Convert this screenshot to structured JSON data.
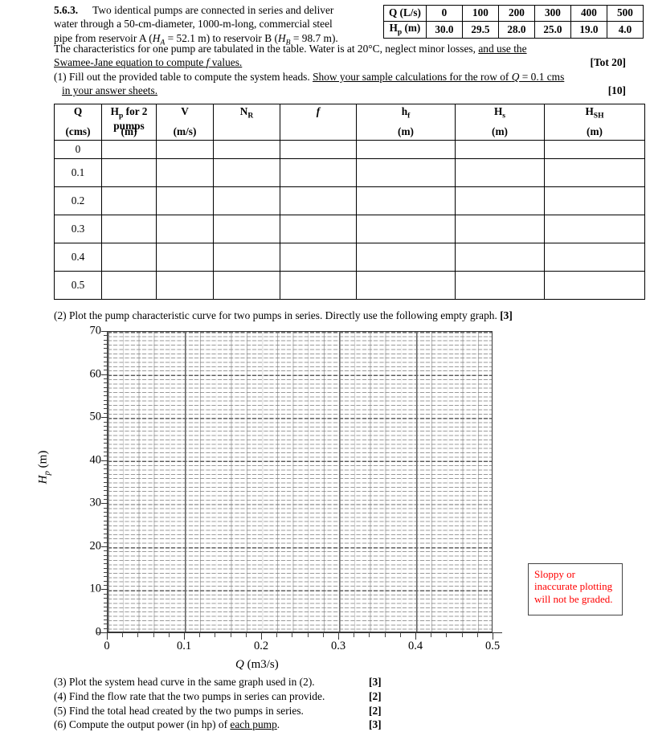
{
  "problem": {
    "number": "5.6.3.",
    "paragraph_1": "Two identical pumps are connected in series and deliver water through a 50-cm-diameter, 1000-m-long, commercial steel pipe from reservoir A (H_A = 52.1 m) to reservoir B (H_B = 98.7 m).",
    "line1": "Two identical pumps are connected in series and deliver",
    "line2a": "water through a 50-cm-diameter, 1000-m-long, commercial steel",
    "line3a": "pipe from reservoir A (",
    "line3b": " = 52.1 m) to reservoir B (",
    "line3c": " = 98.7 m).",
    "ha_sym": "H",
    "ha_sub": "A",
    "hb_sym": "H",
    "hb_sub": "B",
    "line4a": "The characteristics for one pump are tabulated in the table. Water is at 20°C, neglect minor losses, ",
    "line4b": "and use the ",
    "line5a": "Swamee-Jane equation to compute ",
    "line5_f": "f",
    "line5b": " values.",
    "tot_mark": "[Tot 20]",
    "item1_a": "(1) Fill out the provided table to compute the system heads. ",
    "item1_b": "Show your sample calculations for the row of ",
    "item1_q": "Q",
    "item1_c": " = 0.1 cms",
    "item1_d": "in your answer sheets.",
    "item1_mark": "[10]"
  },
  "pump_table": {
    "row_q_label": "Q (L/s)",
    "row_hp_label_main": "H",
    "row_hp_label_sub": "p",
    "row_hp_label_rest": " (m)",
    "q_values": [
      "0",
      "100",
      "200",
      "300",
      "400",
      "500"
    ],
    "hp_values": [
      "30.0",
      "29.5",
      "28.0",
      "25.0",
      "19.0",
      "4.0"
    ]
  },
  "main_table": {
    "headers": [
      {
        "main": "Q",
        "sub": "",
        "second": "",
        "unit": "(cms)"
      },
      {
        "main": "H",
        "sub": "p",
        "second": " for 2",
        "second_line": "pumps",
        "unit": "(m)"
      },
      {
        "main": "V",
        "sub": "",
        "second": "",
        "unit": "(m/s)"
      },
      {
        "main": "N",
        "sub": "R",
        "second": "",
        "unit": ""
      },
      {
        "main": "f",
        "sub": "",
        "second": "",
        "unit": ""
      },
      {
        "main": "h",
        "sub": "f",
        "second": "",
        "unit": "(m)"
      },
      {
        "main": "H",
        "sub": "s",
        "second": "",
        "unit": "(m)"
      },
      {
        "main": "H",
        "sub": "SH",
        "second": "",
        "unit": "(m)"
      }
    ],
    "header_hp_text": "H",
    "header_hp_sub": "p",
    "header_hp_rest": " for 2",
    "header_hp_line2": "pumps",
    "rows": [
      {
        "q": "0",
        "hp": "",
        "v": "",
        "nr": "",
        "f": "",
        "hf": "",
        "hs": "",
        "hsh": ""
      },
      {
        "q": "0.1",
        "hp": "",
        "v": "",
        "nr": "",
        "f": "",
        "hf": "",
        "hs": "",
        "hsh": ""
      },
      {
        "q": "0.2",
        "hp": "",
        "v": "",
        "nr": "",
        "f": "",
        "hf": "",
        "hs": "",
        "hsh": ""
      },
      {
        "q": "0.3",
        "hp": "",
        "v": "",
        "nr": "",
        "f": "",
        "hf": "",
        "hs": "",
        "hsh": ""
      },
      {
        "q": "0.4",
        "hp": "",
        "v": "",
        "nr": "",
        "f": "",
        "hf": "",
        "hs": "",
        "hsh": ""
      },
      {
        "q": "0.5",
        "hp": "",
        "v": "",
        "nr": "",
        "f": "",
        "hf": "",
        "hs": "",
        "hsh": ""
      }
    ]
  },
  "item2": {
    "text": "(2) Plot the pump characteristic curve for two pumps in series. Directly use the following empty graph. ",
    "mark": "[3]"
  },
  "chart_data": {
    "type": "line",
    "title": "",
    "xlabel_main": "Q",
    "xlabel_unit": " (m3/s)",
    "ylabel_main": "H",
    "ylabel_sub": "p",
    "ylabel_unit": " (m)",
    "x_ticks": [
      "0",
      "0.1",
      "0.2",
      "0.3",
      "0.4",
      "0.5"
    ],
    "x_tick_values": [
      0,
      0.1,
      0.2,
      0.3,
      0.4,
      0.5
    ],
    "y_ticks": [
      "0",
      "10",
      "20",
      "30",
      "40",
      "50",
      "60",
      "70"
    ],
    "y_tick_values": [
      0,
      10,
      20,
      30,
      40,
      50,
      60,
      70
    ],
    "xlim": [
      0,
      0.5
    ],
    "ylim": [
      0,
      70
    ],
    "x_minor_per_major": 5,
    "y_minor_per_major": 10,
    "grid": true,
    "grid_style": "major solid dark, minor dashed light",
    "series": [],
    "note": "empty graph provided for student plotting"
  },
  "warning_box": {
    "text": "Sloppy or inaccurate plotting will not be graded."
  },
  "bottom_items": [
    {
      "text": "(3) Plot the system head curve in the same graph used in (2).",
      "mark": "[3]"
    },
    {
      "text": "(4) Find the flow rate that the two pumps in series can provide.",
      "mark": "[2]"
    },
    {
      "text": "(5) Find the total head created by the two pumps in series.",
      "mark": "[2]"
    },
    {
      "text": "(6) Compute the output power (in hp) of each pump.",
      "mark": "[3]",
      "underline_part": "each pump"
    }
  ],
  "colors": {
    "text": "#000000",
    "warning": "#ff0000",
    "grid_major": "#4a4a4a",
    "grid_minor": "#909090",
    "axis": "#333333"
  }
}
